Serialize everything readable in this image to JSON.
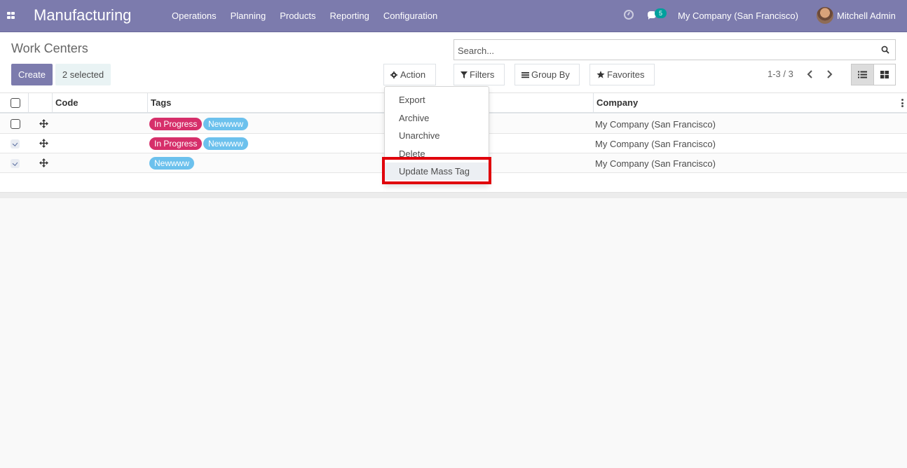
{
  "navbar": {
    "app_name": "Manufacturing",
    "menu": [
      "Operations",
      "Planning",
      "Products",
      "Reporting",
      "Configuration"
    ],
    "chat_count": "5",
    "company": "My Company (San Francisco)",
    "user": "Mitchell Admin",
    "icons": [
      "apps-grid-icon",
      "clock-icon",
      "chat-icon",
      "avatar"
    ]
  },
  "control_panel": {
    "breadcrumb": "Work Centers",
    "create_label": "Create",
    "selected_label": "2 selected",
    "action_label": "Action",
    "search_placeholder": "Search...",
    "filters_label": "Filters",
    "groupby_label": "Group By",
    "favorites_label": "Favorites",
    "pager": "1-3 / 3"
  },
  "action_menu": {
    "items": [
      "Export",
      "Archive",
      "Unarchive",
      "Delete",
      "Update Mass Tag"
    ],
    "highlighted": "Update Mass Tag"
  },
  "table": {
    "columns": [
      "Code",
      "Tags",
      "Company"
    ],
    "rows": [
      {
        "checked": false,
        "code": "",
        "tags": [
          "In Progress",
          "Newwww"
        ],
        "company": "My Company (San Francisco)"
      },
      {
        "checked": true,
        "code": "",
        "tags": [
          "In Progress",
          "Newwww"
        ],
        "company": "My Company (San Francisco)"
      },
      {
        "checked": true,
        "code": "",
        "tags": [
          "Newwww"
        ],
        "company": "My Company (San Francisco)"
      }
    ]
  },
  "colors": {
    "navbar": "#7c7bad",
    "tag_in_progress": "#d62f6a",
    "tag_newwww": "#6cc1ed",
    "highlight": "#e0000b"
  }
}
